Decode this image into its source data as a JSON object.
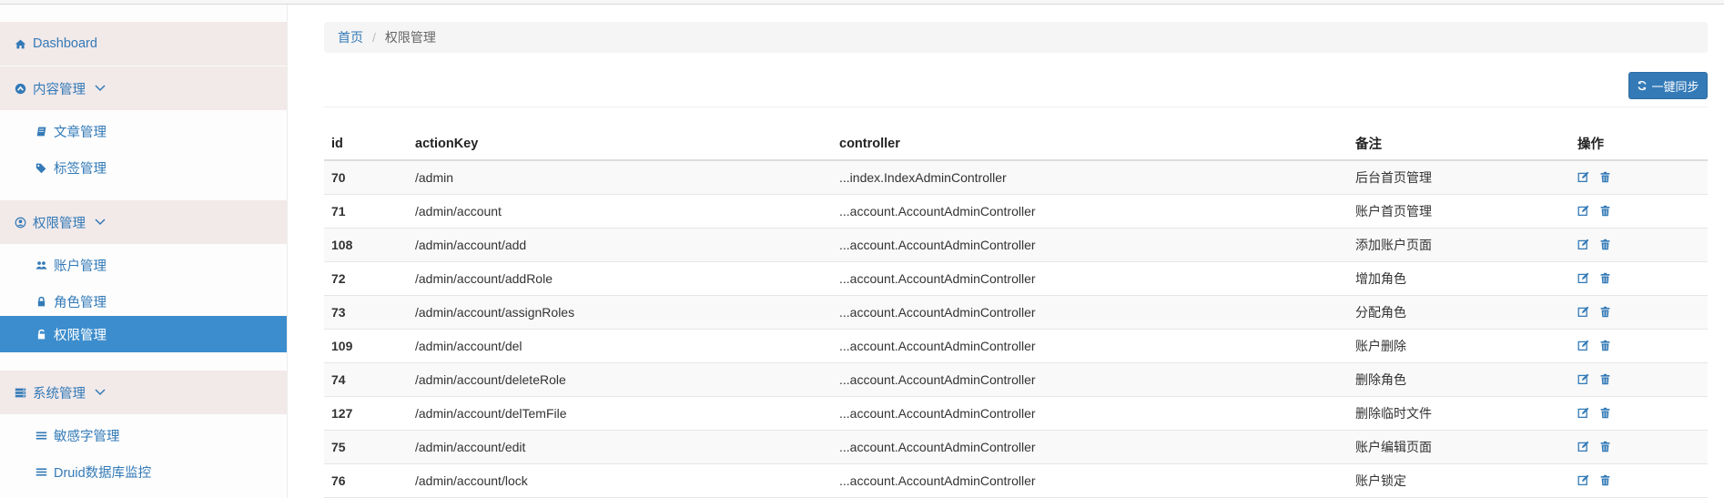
{
  "sidebar": {
    "dashboard": "Dashboard",
    "content_mgmt": "内容管理",
    "article_mgmt": "文章管理",
    "tag_mgmt": "标签管理",
    "perm_group": "权限管理",
    "account_mgmt": "账户管理",
    "role_mgmt": "角色管理",
    "perm_mgmt": "权限管理",
    "system_mgmt": "系统管理",
    "sensitive_mgmt": "敏感字管理",
    "druid_monitor": "Druid数据库监控"
  },
  "breadcrumb": {
    "home": "首页",
    "separator": "/",
    "current": "权限管理"
  },
  "toolbar": {
    "sync_label": "一键同步"
  },
  "table": {
    "headers": {
      "id": "id",
      "actionKey": "actionKey",
      "controller": "controller",
      "note": "备注",
      "ops": "操作"
    },
    "rows": [
      {
        "id": "70",
        "actionKey": "/admin",
        "controller": "...index.IndexAdminController",
        "note": "后台首页管理"
      },
      {
        "id": "71",
        "actionKey": "/admin/account",
        "controller": "...account.AccountAdminController",
        "note": "账户首页管理"
      },
      {
        "id": "108",
        "actionKey": "/admin/account/add",
        "controller": "...account.AccountAdminController",
        "note": "添加账户页面"
      },
      {
        "id": "72",
        "actionKey": "/admin/account/addRole",
        "controller": "...account.AccountAdminController",
        "note": "增加角色"
      },
      {
        "id": "73",
        "actionKey": "/admin/account/assignRoles",
        "controller": "...account.AccountAdminController",
        "note": "分配角色"
      },
      {
        "id": "109",
        "actionKey": "/admin/account/del",
        "controller": "...account.AccountAdminController",
        "note": "账户删除"
      },
      {
        "id": "74",
        "actionKey": "/admin/account/deleteRole",
        "controller": "...account.AccountAdminController",
        "note": "删除角色"
      },
      {
        "id": "127",
        "actionKey": "/admin/account/delTemFile",
        "controller": "...account.AccountAdminController",
        "note": "删除临时文件"
      },
      {
        "id": "75",
        "actionKey": "/admin/account/edit",
        "controller": "...account.AccountAdminController",
        "note": "账户编辑页面"
      },
      {
        "id": "76",
        "actionKey": "/admin/account/lock",
        "controller": "...account.AccountAdminController",
        "note": "账户锁定"
      }
    ]
  },
  "icons": {
    "edit": "edit-icon",
    "delete": "trash-icon"
  },
  "colors": {
    "primary": "#337ab7",
    "active_bg": "#3c8dcd",
    "group_bg": "#f2e9e9"
  }
}
